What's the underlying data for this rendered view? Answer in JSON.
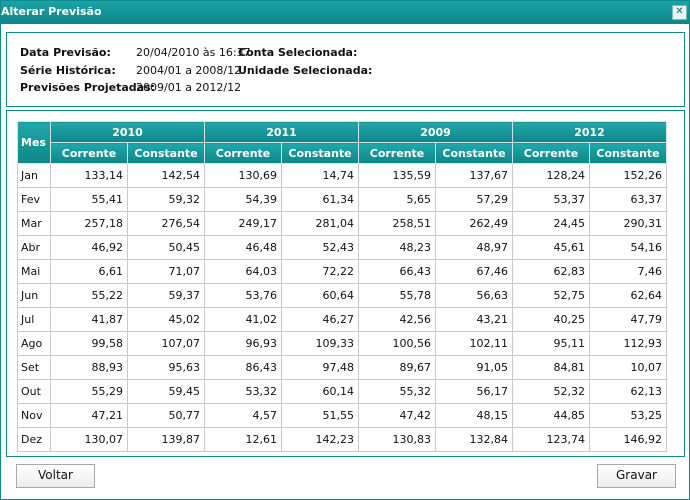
{
  "window": {
    "title": "Alterar Previsão",
    "close_label": "✕"
  },
  "info": {
    "data_previsao_label": "Data Previsão:",
    "data_previsao_value": "20/04/2010 às 16:37",
    "serie_label": "Série Histórica:",
    "serie_value": "2004/01 a 2008/12",
    "previsoes_label": "Previsões Projetadas:",
    "previsoes_value": "2009/01 a 2012/12",
    "conta_label": "Conta Selecionada:",
    "unidade_label": "Unidade Selecionada:"
  },
  "table": {
    "mes_header": "Mes",
    "years": [
      "2010",
      "2011",
      "2009",
      "2012"
    ],
    "sub_headers": [
      "Corrente",
      "Constante"
    ],
    "rows": [
      {
        "month": "Jan",
        "values": [
          "133,14",
          "142,54",
          "130,69",
          "14,74",
          "135,59",
          "137,67",
          "128,24",
          "152,26"
        ]
      },
      {
        "month": "Fev",
        "values": [
          "55,41",
          "59,32",
          "54,39",
          "61,34",
          "5,65",
          "57,29",
          "53,37",
          "63,37"
        ]
      },
      {
        "month": "Mar",
        "values": [
          "257,18",
          "276,54",
          "249,17",
          "281,04",
          "258,51",
          "262,49",
          "24,45",
          "290,31"
        ]
      },
      {
        "month": "Abr",
        "values": [
          "46,92",
          "50,45",
          "46,48",
          "52,43",
          "48,23",
          "48,97",
          "45,61",
          "54,16"
        ]
      },
      {
        "month": "Mai",
        "values": [
          "6,61",
          "71,07",
          "64,03",
          "72,22",
          "66,43",
          "67,46",
          "62,83",
          "7,46"
        ]
      },
      {
        "month": "Jun",
        "values": [
          "55,22",
          "59,37",
          "53,76",
          "60,64",
          "55,78",
          "56,63",
          "52,75",
          "62,64"
        ]
      },
      {
        "month": "Jul",
        "values": [
          "41,87",
          "45,02",
          "41,02",
          "46,27",
          "42,56",
          "43,21",
          "40,25",
          "47,79"
        ]
      },
      {
        "month": "Ago",
        "values": [
          "99,58",
          "107,07",
          "96,93",
          "109,33",
          "100,56",
          "102,11",
          "95,11",
          "112,93"
        ]
      },
      {
        "month": "Set",
        "values": [
          "88,93",
          "95,63",
          "86,43",
          "97,48",
          "89,67",
          "91,05",
          "84,81",
          "10,07"
        ]
      },
      {
        "month": "Out",
        "values": [
          "55,29",
          "59,45",
          "53,32",
          "60,14",
          "55,32",
          "56,17",
          "52,32",
          "62,13"
        ]
      },
      {
        "month": "Nov",
        "values": [
          "47,21",
          "50,77",
          "4,57",
          "51,55",
          "47,42",
          "48,15",
          "44,85",
          "53,25"
        ]
      },
      {
        "month": "Dez",
        "values": [
          "130,07",
          "139,87",
          "12,61",
          "142,23",
          "130,83",
          "132,84",
          "123,74",
          "146,92"
        ]
      }
    ]
  },
  "buttons": {
    "voltar": "Voltar",
    "gravar": "Gravar"
  },
  "colors": {
    "accent": "#0f8a8c"
  }
}
